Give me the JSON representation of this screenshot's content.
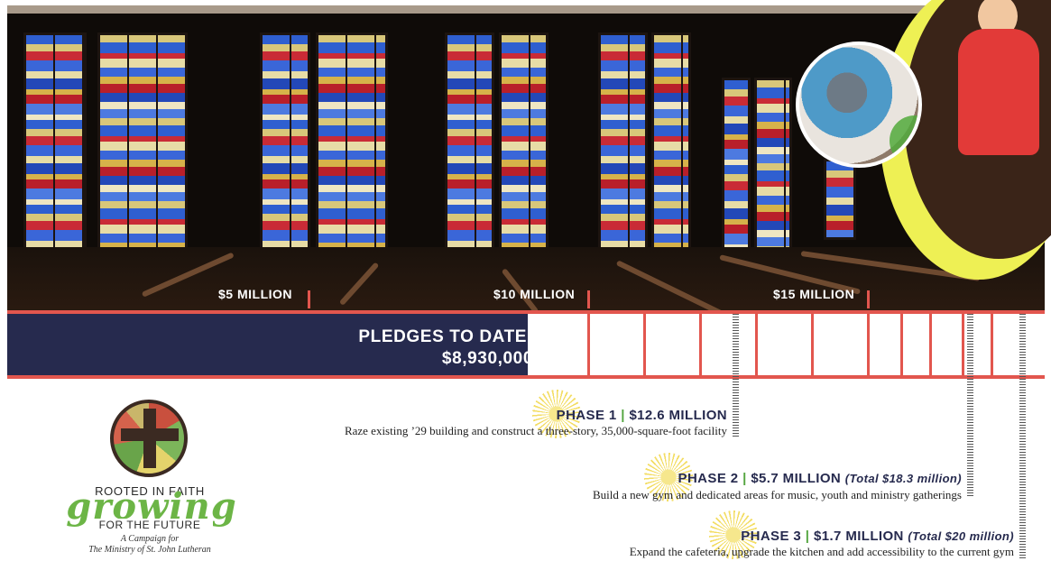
{
  "milestones": {
    "m5": "$5 MILLION",
    "m10": "$10 MILLION",
    "m15": "$15 MILLION"
  },
  "pledges": {
    "label": "PLEDGES TO DATE:",
    "amount": "$8,930,000",
    "progress_millions": 8.93,
    "goal_millions": 20
  },
  "phases": [
    {
      "name": "PHASE 1",
      "amount": "$12.6 MILLION",
      "total": "",
      "description": "Raze existing ’29 building and construct a three-story, 35,000-square-foot facility"
    },
    {
      "name": "PHASE 2",
      "amount": "$5.7 MILLION",
      "total": "(Total $18.3 million)",
      "description": "Build a new gym and dedicated areas for music, youth and ministry gatherings"
    },
    {
      "name": "PHASE 3",
      "amount": "$1.7 MILLION",
      "total": "(Total $20 million)",
      "description": "Expand the cafeteria, upgrade the kitchen and add accessibility to the current gym"
    }
  ],
  "separator": "|",
  "logo": {
    "line1": "ROOTED IN FAITH",
    "script": "growing",
    "line3": "FOR THE FUTURE",
    "sub1": "A Campaign for",
    "sub2": "The Ministry of St. John Lutheran"
  },
  "colors": {
    "navy": "#262a4e",
    "coral": "#e2564e",
    "green": "#55a641",
    "yellow": "#eef054"
  },
  "icons": [
    "stained-glass-photo",
    "kids-photo",
    "sunburst-icon",
    "cross-logo-icon"
  ]
}
